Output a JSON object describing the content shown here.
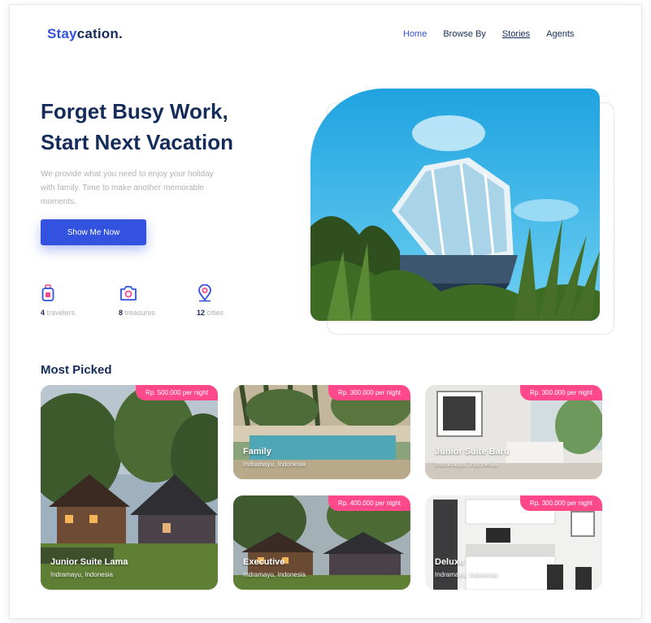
{
  "header": {
    "brand_part1": "Stay",
    "brand_part2": "cation.",
    "nav": [
      "Home",
      "Browse By",
      "Stories",
      "Agents"
    ]
  },
  "hero": {
    "title_line1": "Forget Busy Work,",
    "title_line2": "Start Next Vacation",
    "description": "We provide what you need to enjoy your holiday with family. Time to make another memorable moments.",
    "cta_label": "Show Me Now",
    "stats": [
      {
        "icon": "traveler-icon",
        "value": "4",
        "label": "travelers"
      },
      {
        "icon": "camera-icon",
        "value": "8",
        "label": "treasures"
      },
      {
        "icon": "location-pin-icon",
        "value": "12",
        "label": "cities"
      }
    ]
  },
  "most_picked": {
    "title": "Most Picked",
    "items": [
      {
        "price": "Rp. 500.000 per night",
        "name": "Junior Suite Lama",
        "location": "Indramayu, Indonesia"
      },
      {
        "price": "Rp. 300.000 per night",
        "name": "Family",
        "location": "Indramayu, Indonesia"
      },
      {
        "price": "Rp. 300.000 per night",
        "name": "Junior Suite Baru",
        "location": "Indramayu, Indonesia"
      },
      {
        "price": "Rp. 400.000 per night",
        "name": "Executive",
        "location": "Indramayu, Indonesia"
      },
      {
        "price": "Rp. 300.000 per night",
        "name": "Deluxe",
        "location": "Indramayu, Indonesia"
      }
    ]
  },
  "colors": {
    "primary": "#3252df",
    "navy": "#152c5b",
    "accent_pink": "#ff498b",
    "muted_text": "#b0b0b0"
  }
}
